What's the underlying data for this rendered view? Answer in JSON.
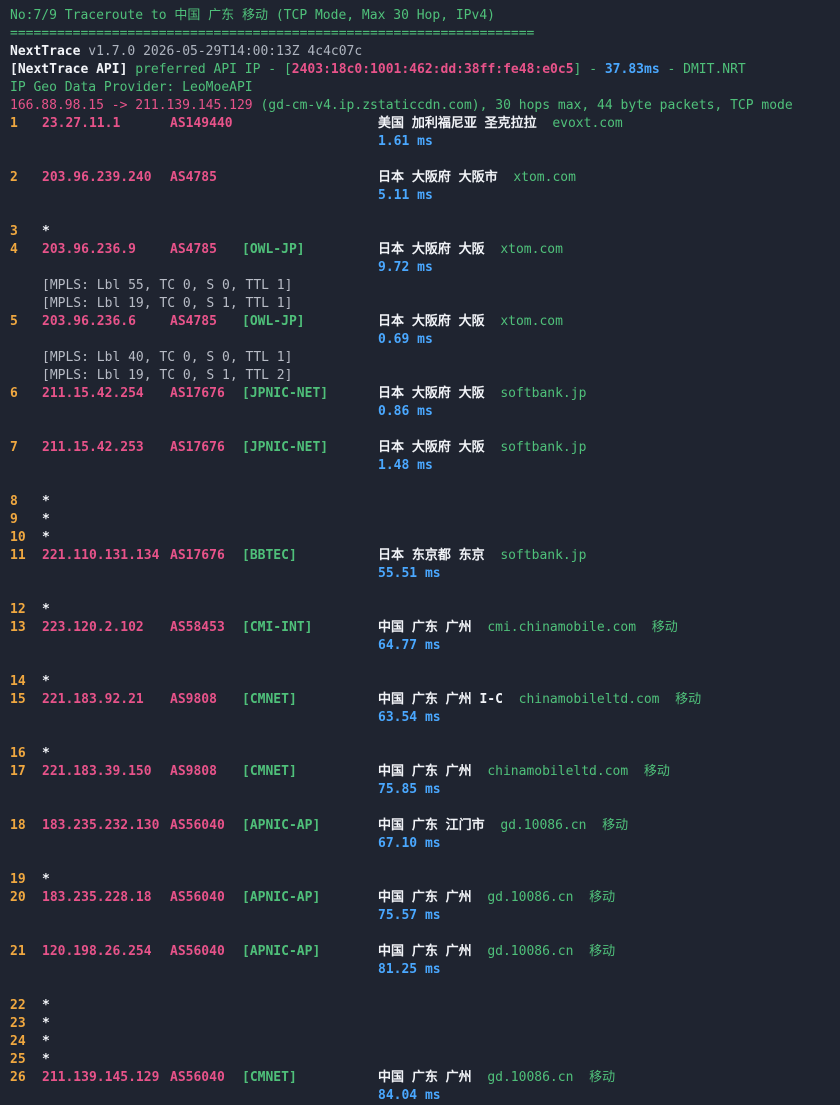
{
  "header": {
    "title": "No:7/9 Traceroute to 中国 广东 移动 (TCP Mode, Max 30 Hop, IPv4)",
    "separator": "===================================================================",
    "version_name": "NextTrace",
    "version_rest": " v1.7.0 2026-05-29T14:00:13Z 4c4c07c",
    "api_label": "[NextTrace API]",
    "api_pref": " preferred API IP - [",
    "api_ip": "2403:18c0:1001:462:dd:38ff:fe48:e0c5",
    "api_close": "] - ",
    "api_latency": "37.83ms",
    "api_node": " - DMIT.NRT",
    "geo_provider": "IP Geo Data Provider: LeoMoeAPI",
    "route_src_dst": "166.88.98.15 -> 211.139.145.129",
    "route_rest": " (gd-cm-v4.ip.zstaticcdn.com), 30 hops max, 44 byte packets, TCP mode"
  },
  "hops": [
    {
      "n": "1",
      "ip": "23.27.11.1",
      "asn": "AS149440",
      "tag": "",
      "geo": "美国 加利福尼亚 圣克拉拉",
      "host": "evoxt.com",
      "isp": "",
      "rtt": "1.61 ms"
    },
    {
      "n": "2",
      "ip": "203.96.239.240",
      "asn": "AS4785",
      "tag": "",
      "geo": "日本 大阪府 大阪市",
      "host": "xtom.com",
      "isp": "",
      "rtt": "5.11 ms"
    },
    {
      "n": "3",
      "star": true
    },
    {
      "n": "4",
      "ip": "203.96.236.9",
      "asn": "AS4785",
      "tag": "[OWL-JP]",
      "geo": "日本 大阪府 大阪",
      "host": "xtom.com",
      "isp": "",
      "rtt": "9.72 ms",
      "mpls": [
        "[MPLS: Lbl 55, TC 0, S 0, TTL 1]",
        "[MPLS: Lbl 19, TC 0, S 1, TTL 1]"
      ]
    },
    {
      "n": "5",
      "ip": "203.96.236.6",
      "asn": "AS4785",
      "tag": "[OWL-JP]",
      "geo": "日本 大阪府 大阪",
      "host": "xtom.com",
      "isp": "",
      "rtt": "0.69 ms",
      "mpls": [
        "[MPLS: Lbl 40, TC 0, S 0, TTL 1]",
        "[MPLS: Lbl 19, TC 0, S 1, TTL 2]"
      ]
    },
    {
      "n": "6",
      "ip": "211.15.42.254",
      "asn": "AS17676",
      "tag": "[JPNIC-NET]",
      "geo": "日本 大阪府 大阪",
      "host": "softbank.jp",
      "isp": "",
      "rtt": "0.86 ms"
    },
    {
      "n": "7",
      "ip": "211.15.42.253",
      "asn": "AS17676",
      "tag": "[JPNIC-NET]",
      "geo": "日本 大阪府 大阪",
      "host": "softbank.jp",
      "isp": "",
      "rtt": "1.48 ms"
    },
    {
      "n": "8",
      "star": true
    },
    {
      "n": "9",
      "star": true
    },
    {
      "n": "10",
      "star": true
    },
    {
      "n": "11",
      "ip": "221.110.131.134",
      "asn": "AS17676",
      "tag": "[BBTEC]",
      "geo": "日本 东京都 东京",
      "host": "softbank.jp",
      "isp": "",
      "rtt": "55.51 ms"
    },
    {
      "n": "12",
      "star": true
    },
    {
      "n": "13",
      "ip": "223.120.2.102",
      "asn": "AS58453",
      "tag": "[CMI-INT]",
      "geo": "中国 广东 广州",
      "host": "cmi.chinamobile.com",
      "isp": "移动",
      "rtt": "64.77 ms"
    },
    {
      "n": "14",
      "star": true
    },
    {
      "n": "15",
      "ip": "221.183.92.21",
      "asn": "AS9808",
      "tag": "[CMNET]",
      "geo": "中国 广东 广州 I-C",
      "host": "chinamobileltd.com",
      "isp": "移动",
      "rtt": "63.54 ms"
    },
    {
      "n": "16",
      "star": true
    },
    {
      "n": "17",
      "ip": "221.183.39.150",
      "asn": "AS9808",
      "tag": "[CMNET]",
      "geo": "中国 广东 广州",
      "host": "chinamobileltd.com",
      "isp": "移动",
      "rtt": "75.85 ms"
    },
    {
      "n": "18",
      "ip": "183.235.232.130",
      "asn": "AS56040",
      "tag": "[APNIC-AP]",
      "geo": "中国 广东 江门市",
      "host": "gd.10086.cn",
      "isp": "移动",
      "rtt": "67.10 ms"
    },
    {
      "n": "19",
      "star": true
    },
    {
      "n": "20",
      "ip": "183.235.228.18",
      "asn": "AS56040",
      "tag": "[APNIC-AP]",
      "geo": "中国 广东 广州",
      "host": "gd.10086.cn",
      "isp": "移动",
      "rtt": "75.57 ms"
    },
    {
      "n": "21",
      "ip": "120.198.26.254",
      "asn": "AS56040",
      "tag": "[APNIC-AP]",
      "geo": "中国 广东 广州",
      "host": "gd.10086.cn",
      "isp": "移动",
      "rtt": "81.25 ms"
    },
    {
      "n": "22",
      "star": true
    },
    {
      "n": "23",
      "star": true
    },
    {
      "n": "24",
      "star": true
    },
    {
      "n": "25",
      "star": true
    },
    {
      "n": "26",
      "ip": "211.139.145.129",
      "asn": "AS56040",
      "tag": "[CMNET]",
      "geo": "中国 广东 广州",
      "host": "gd.10086.cn",
      "isp": "移动",
      "rtt": "84.04 ms"
    }
  ],
  "star_symbol": "*",
  "colors": {
    "background": "#1f2430",
    "hop_number": "#f0a840",
    "ip": "#e8538a",
    "tag": "#4fc07a",
    "rtt": "#4aa8ff"
  }
}
